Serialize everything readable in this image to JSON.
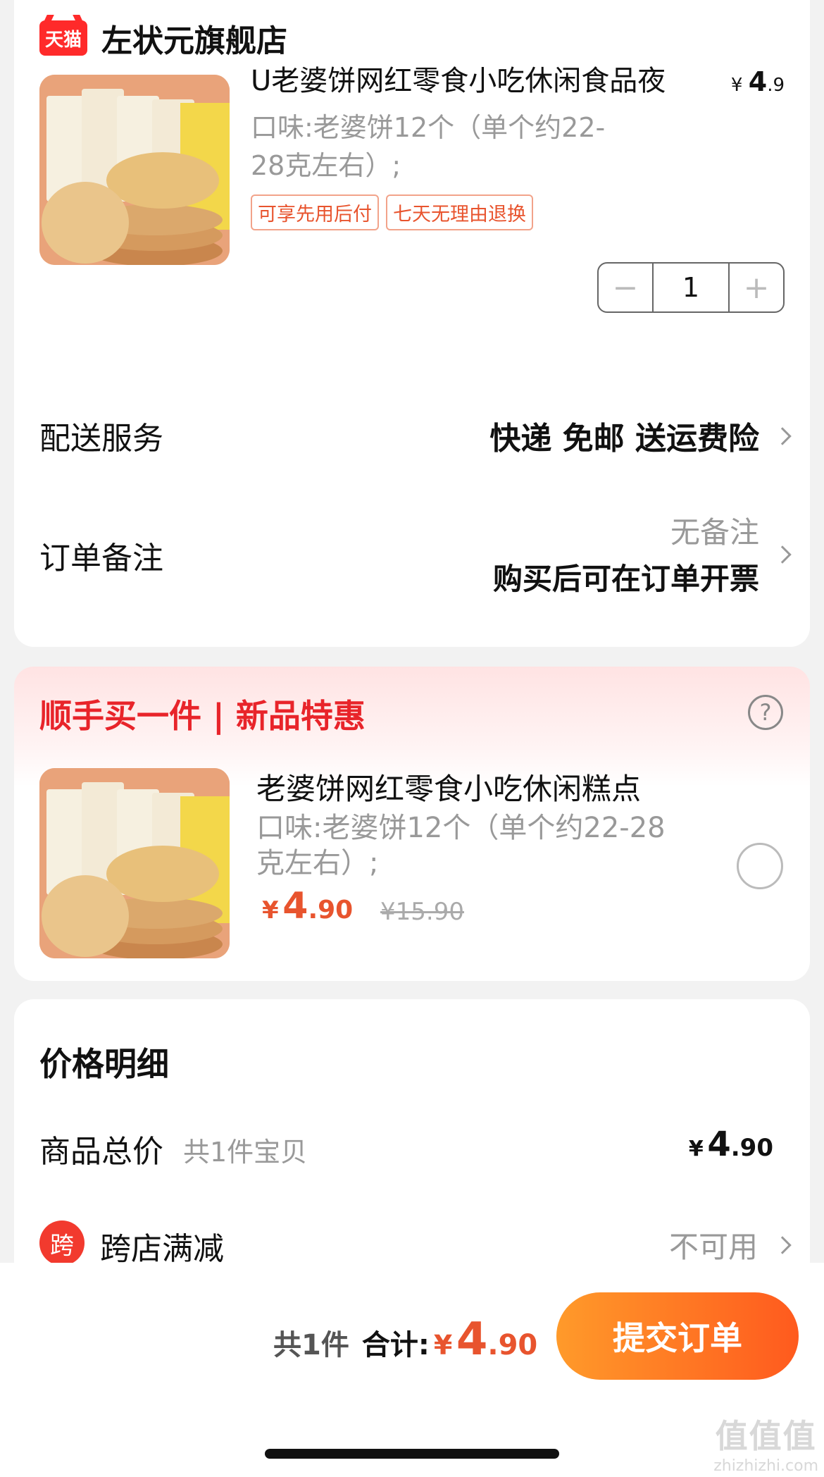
{
  "store": {
    "logo_text": "天猫",
    "name": "左状元旗舰店"
  },
  "product": {
    "title": "U老婆饼网红零食小吃休闲食品夜",
    "price_currency": "¥",
    "price_main": "4",
    "price_decimal": ".9",
    "spec": "口味:老婆饼12个（单个约22-28克左右）;",
    "tags": [
      "可享先用后付",
      "七天无理由退换"
    ],
    "quantity": "1",
    "minus": "−",
    "plus": "+"
  },
  "delivery": {
    "label": "配送服务",
    "value": "快递 免邮 送运费险"
  },
  "order_note": {
    "label": "订单备注",
    "value": "无备注",
    "hint": "购买后可在订单开票"
  },
  "addon": {
    "title": "顺手买一件 | 新品特惠",
    "help_icon": "?",
    "name": "老婆饼网红零食小吃休闲糕点",
    "spec": "口味:老婆饼12个（单个约22-28克左右）;",
    "price_currency": "¥",
    "price_main": "4",
    "price_decimal": ".90",
    "original_price": "¥15.90"
  },
  "price_detail": {
    "title": "价格明细",
    "total_label": "商品总价",
    "total_count": "共1件宝贝",
    "total_currency": "¥",
    "total_main": "4",
    "total_decimal": ".90",
    "cross_store_badge": "跨",
    "cross_store_label": "跨店满减",
    "cross_store_value": "不可用"
  },
  "footer": {
    "count": "共1件",
    "sum_label": "合计:",
    "currency": "¥",
    "main": "4",
    "decimal": ".90",
    "submit": "提交订单"
  },
  "watermark": {
    "big": "值值值",
    "small": "zhizhizhi.com"
  },
  "colors": {
    "accent": "#e8542e",
    "red": "#e8242a",
    "button_start": "#ff9a2a",
    "button_end": "#ff5a1e"
  }
}
